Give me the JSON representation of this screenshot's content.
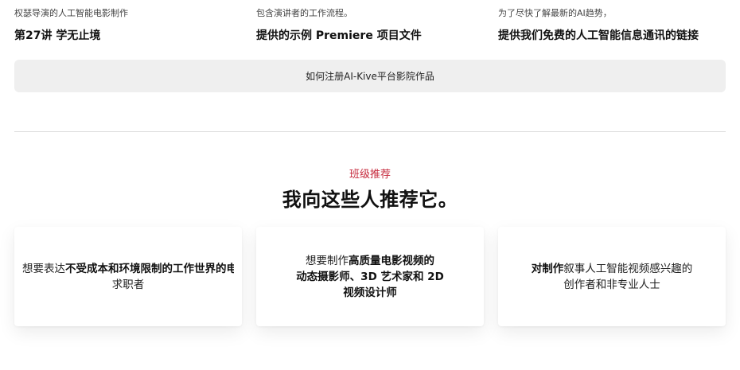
{
  "features": [
    {
      "subtitle": "权瑟导演的人工智能电影制作",
      "title": "第27讲 学无止境"
    },
    {
      "subtitle": "包含演讲者的工作流程。",
      "title": "提供的示例 Premiere 项目文件"
    },
    {
      "subtitle": "为了尽快了解最新的AI趋势，",
      "title": "提供我们免费的人工智能信息通讯的链接"
    }
  ],
  "banner": {
    "label": "如何注册AI-Kive平台影院作品"
  },
  "section": {
    "eyebrow": "班级推荐",
    "heading": "我向这些人推荐它。"
  },
  "cards": [
    {
      "pre": "想要表达",
      "bold": "不受成本和环境限制的工作世界的电",
      "line2": "求职者"
    },
    {
      "pre": "想要制作",
      "bold": "高质量电影视频的",
      "line2": "动态摄影师、3D 艺术家和 2D",
      "line3": "视频设计师"
    },
    {
      "bold": "对制作",
      "post": "叙事人工智能视频感兴趣的",
      "line2": "创作者和非专业人士"
    }
  ],
  "colors": {
    "accent": "#c6293c",
    "banner_bg": "#efefef",
    "divider": "#dcdcdc"
  }
}
